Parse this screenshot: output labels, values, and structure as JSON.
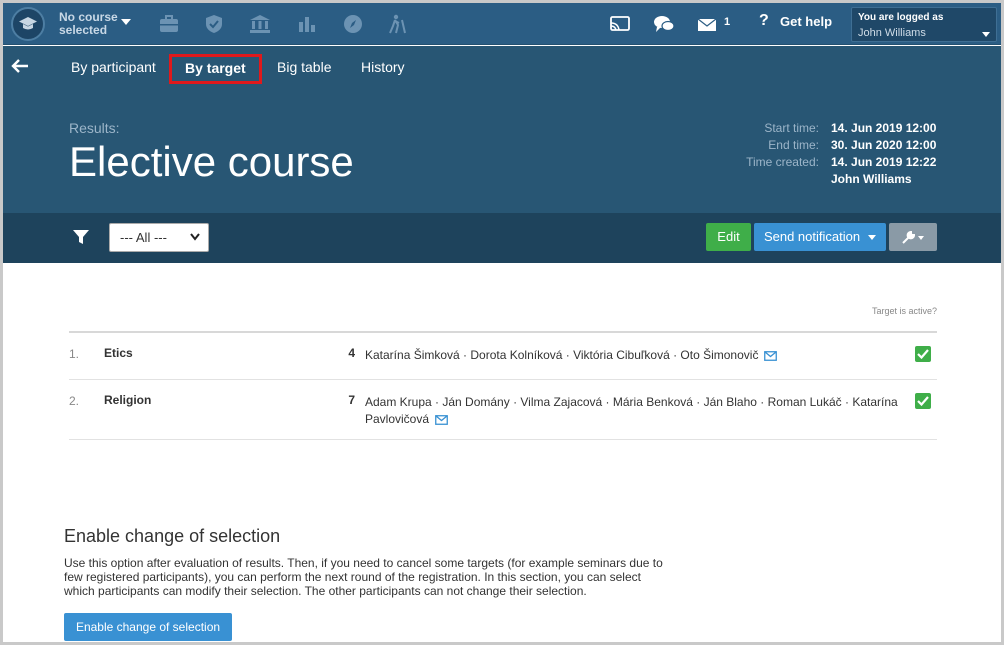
{
  "topbar": {
    "course_line1": "No course",
    "course_line2": "selected",
    "messages_count": "1",
    "help_label": "Get help",
    "login_title": "You are logged as",
    "login_name": "John Williams"
  },
  "tabs": [
    {
      "label": "By participant",
      "active": false
    },
    {
      "label": "By target",
      "active": true
    },
    {
      "label": "Big table",
      "active": false
    },
    {
      "label": "History",
      "active": false
    }
  ],
  "header": {
    "results_label": "Results:",
    "title": "Elective course",
    "meta_labels": [
      "Start time:",
      "End time:",
      "Time created:"
    ],
    "start_time": "14. Jun 2019 12:00",
    "end_time": "30. Jun 2020 12:00",
    "time_created": "14. Jun 2019 12:22",
    "created_by": "John Williams"
  },
  "toolbar": {
    "filter_value": "--- All ---",
    "edit_label": "Edit",
    "send_label": "Send notification"
  },
  "table": {
    "active_header": "Target is active?",
    "rows": [
      {
        "num": "1.",
        "name": "Etics",
        "count": "4",
        "participants": "Katarína Šimková · Dorota Kolníková · Viktória Cibuľková · Oto Šimonovič",
        "active": true
      },
      {
        "num": "2.",
        "name": "Religion",
        "count": "7",
        "participants": "Adam Krupa · Ján Domány · Vilma Zajacová · Mária Benková · Ján Blaho · Roman Lukáč · Katarína Pavlovičová",
        "active": true
      }
    ]
  },
  "section": {
    "title": "Enable change of selection",
    "description": "Use this option after evaluation of results. Then, if you need to cancel some targets (for example seminars due to few registered participants), you can perform the next round of the registration. In this section, you can select which participants can modify their selection. The other participants can not change their selection.",
    "button_label": "Enable change of selection"
  },
  "colors": {
    "topbar": "#2b5d84",
    "hero": "#285674",
    "toolbar": "#1e435c",
    "green": "#3fae49",
    "blue": "#3991d3",
    "active_tab_outline": "#e0191c"
  }
}
